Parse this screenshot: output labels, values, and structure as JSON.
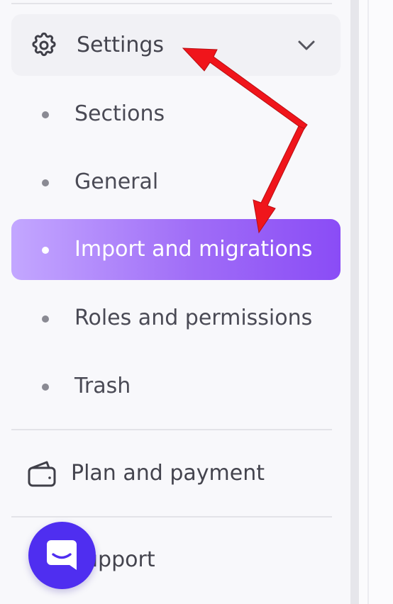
{
  "sidebar": {
    "settings": {
      "label": "Settings",
      "icon": "gear-icon",
      "expand_icon": "chevron-down-icon"
    },
    "sub_items": [
      {
        "label": "Sections",
        "active": false
      },
      {
        "label": "General",
        "active": false
      },
      {
        "label": "Import and migrations",
        "active": true
      },
      {
        "label": "Roles and permissions",
        "active": false
      },
      {
        "label": "Trash",
        "active": false
      }
    ],
    "plan": {
      "label": "Plan and payment",
      "icon": "wallet-icon"
    },
    "support": {
      "label": "Support"
    }
  },
  "chat_widget": {
    "icon": "chat-smile-icon",
    "color": "#4f2ef0"
  },
  "colors": {
    "active_gradient_start": "#c3a7ff",
    "active_gradient_end": "#8a4cf6",
    "annotation_arrow": "#f0151b"
  }
}
